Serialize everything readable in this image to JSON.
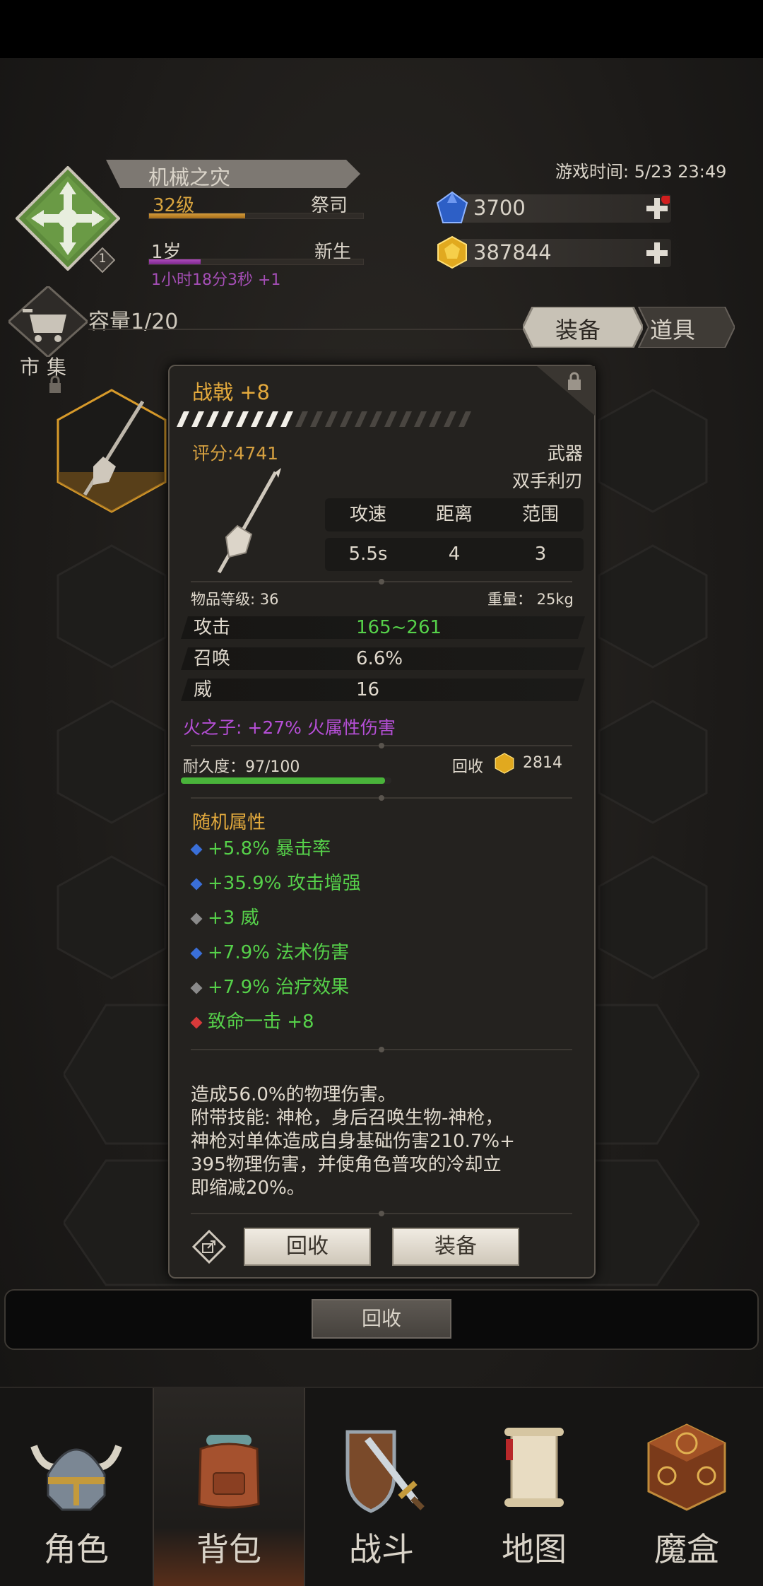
{
  "header": {
    "player_name": "机械之灾",
    "level": "32级",
    "job": "祭司",
    "badge_num": "1",
    "age": "1岁",
    "age_stage": "新生",
    "timer": "1小时18分3秒 +1",
    "game_time": "游戏时间: 5/23 23:49",
    "gems": "3700",
    "gold": "387844",
    "exp_fraction": 0.45,
    "age_fraction": 0.24
  },
  "inventory": {
    "market_label": "市集",
    "capacity": "容量1/20",
    "tabs": [
      "装备",
      "道具"
    ]
  },
  "item": {
    "name": "战戟 +8",
    "score": "评分:4741",
    "type": "武器",
    "subtype": "双手利刃",
    "stats_headers": [
      "攻速",
      "距离",
      "范围"
    ],
    "stats_values": [
      "5.5s",
      "4",
      "3"
    ],
    "item_level": "物品等级: 36",
    "weight": "重量： 25kg",
    "attributes": [
      {
        "key": "攻击",
        "value": "165~261",
        "color": "#56d14a"
      },
      {
        "key": "召唤",
        "value": "6.6%",
        "color": "#e0d9cd"
      },
      {
        "key": "威",
        "value": "16",
        "color": "#e0d9cd"
      }
    ],
    "fire_bonus": "火之子: +27% 火属性伤害",
    "durability": "耐久度：97/100",
    "durability_fraction": 0.97,
    "recycle_label": "回收",
    "recycle_value": "2814",
    "random_title": "随机属性",
    "random_attrs": [
      {
        "text": "+5.8% 暴击率",
        "dot": "#3a6fd8"
      },
      {
        "text": "+35.9% 攻击增强",
        "dot": "#3a6fd8"
      },
      {
        "text": "+3 威",
        "dot": "#8a8a8a"
      },
      {
        "text": "+7.9% 法术伤害",
        "dot": "#3a6fd8"
      },
      {
        "text": "+7.9% 治疗效果",
        "dot": "#8a8a8a"
      },
      {
        "text": "致命一击 +8",
        "dot": "#d83a3a"
      }
    ],
    "desc_lines": [
      "造成56.0%的物理伤害。",
      "附带技能: 神枪，身后召唤生物-神枪，",
      "神枪对单体造成自身基础伤害210.7%+",
      "395物理伤害，并使角色普攻的冷却立",
      "即缩减20%。"
    ],
    "btn_recycle": "回收",
    "btn_equip": "装备"
  },
  "action_bar": {
    "recycle": "回收"
  },
  "nav": [
    "角色",
    "背包",
    "战斗",
    "地图",
    "魔盒"
  ]
}
